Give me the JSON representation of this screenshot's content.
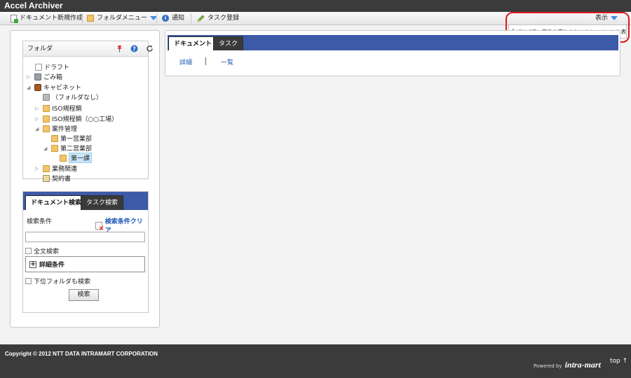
{
  "app": {
    "title": "Accel Archiver"
  },
  "toolbar": {
    "new_doc": "ドキュメント新規作成",
    "folder_menu": "フォルダメニュー",
    "notice": "通知",
    "task_register": "タスク登録",
    "display": "表示",
    "dropdown_option": "プロパティ要件を満たさないドキュメントを表示する"
  },
  "folder_panel": {
    "title": "フォルダ",
    "tree": [
      {
        "label": "ドラフト"
      },
      {
        "label": "ごみ箱"
      },
      {
        "label": "キャビネット"
      },
      {
        "label": "（フォルダなし）"
      },
      {
        "label": "ISO規程類"
      },
      {
        "label": "ISO規程類（○○工場）"
      },
      {
        "label": "案件管理"
      },
      {
        "label": "第一営業部"
      },
      {
        "label": "第二営業部"
      },
      {
        "label": "第一課"
      },
      {
        "label": "業務関連"
      },
      {
        "label": "契約書"
      }
    ]
  },
  "search_panel": {
    "tabs": [
      "ドキュメント検索",
      "タスク検索"
    ],
    "condition_label": "検索条件",
    "clear_label": "検索条件クリア",
    "search_value": "",
    "fulltext_label": "全文検索",
    "detail_label": "詳細条件",
    "subfolder_label": "下位フォルダも検索",
    "search_button": "検索"
  },
  "main_panel": {
    "tabs": [
      "ドキュメント",
      "タスク"
    ],
    "links": [
      "詳細",
      "一覧"
    ]
  },
  "footer": {
    "copyright": "Copyright © 2012 NTT DATA INTRAMART CORPORATION",
    "powered_by": "Powered by",
    "brand": "intra-mart",
    "top_link": "top ↑"
  },
  "colors": {
    "title_bar": "#3b3b3b",
    "tab_bar": "#3d5aa8",
    "link": "#1f56b8",
    "highlight": "#e0161b"
  }
}
